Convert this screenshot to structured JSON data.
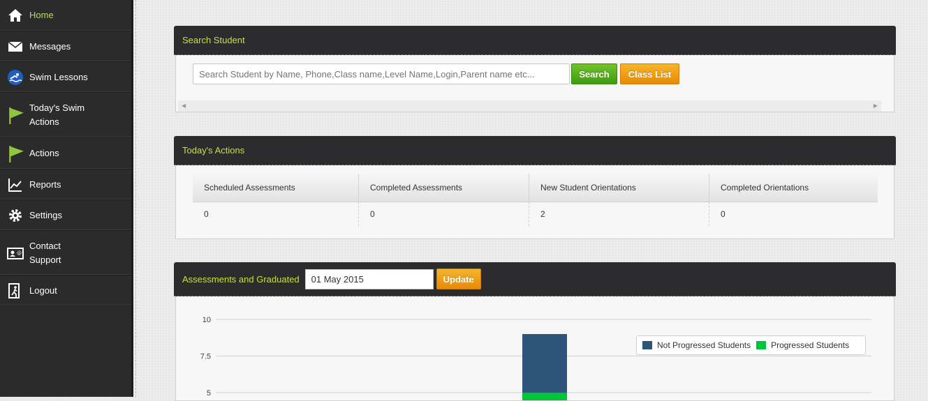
{
  "sidebar": {
    "items": [
      {
        "label": "Home",
        "icon": "home-icon",
        "active": true
      },
      {
        "label": "Messages",
        "icon": "envelope-icon"
      },
      {
        "label": "Swim Lessons",
        "icon": "swimmer-icon"
      },
      {
        "label": "Today's Swim Actions",
        "icon": "flag-icon"
      },
      {
        "label": "Actions",
        "icon": "flag-icon"
      },
      {
        "label": "Reports",
        "icon": "line-chart-icon"
      },
      {
        "label": "Settings",
        "icon": "gear-icon"
      },
      {
        "label": "Contact Support",
        "icon": "contact-card-icon"
      },
      {
        "label": "Logout",
        "icon": "exit-icon"
      }
    ]
  },
  "search_panel": {
    "title": "Search Student",
    "placeholder": "Search Student by Name, Phone,Class name,Level Name,Login,Parent name etc...",
    "search_label": "Search",
    "classlist_label": "Class List"
  },
  "actions_panel": {
    "title": "Today's Actions",
    "columns": [
      "Scheduled Assessments",
      "Completed Assessments",
      "New Student Orientations",
      "Completed Orientations"
    ],
    "values": [
      "0",
      "0",
      "2",
      "0"
    ]
  },
  "chart_panel": {
    "title": "Assessments and Graduated",
    "date_value": "01 May 2015",
    "update_label": "Update"
  },
  "colors": {
    "accent_text": "#c8e03c",
    "not_progressed": "#2e5479",
    "progressed": "#00c43a"
  },
  "chart_data": {
    "type": "bar",
    "stacked": true,
    "y_ticks": [
      "10",
      "7.5",
      "5"
    ],
    "ylim": [
      5,
      10
    ],
    "visible_note": "chart cropped at bottom; only upper portion shown",
    "series": [
      {
        "name": "Not Progressed Students",
        "color": "#2e5479",
        "values": [
          9
        ]
      },
      {
        "name": "Progressed Students",
        "color": "#00c43a",
        "values": [
          5
        ]
      }
    ],
    "legend_position": "top-right"
  }
}
